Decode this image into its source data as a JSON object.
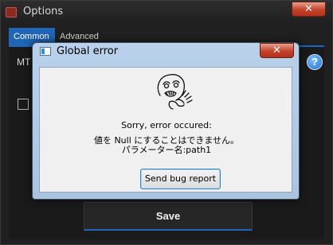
{
  "options_window": {
    "title": "Options",
    "close_glyph": "✕",
    "tabs": [
      {
        "label": "Common",
        "active": true
      },
      {
        "label": "Advanced",
        "active": false
      }
    ],
    "mt_label": "MT",
    "help_glyph": "?",
    "save_label": "Save"
  },
  "error_dialog": {
    "title": "Global error",
    "close_glyph": "✕",
    "icon": "rage-face-icon",
    "message": "Sorry, error occured:",
    "detail_line1": "値を Null にすることはできません。",
    "detail_line2": "パラメーター名:path1",
    "button_label": "Send bug report"
  },
  "colors": {
    "accent_blue": "#1f66b8",
    "close_red": "#c4412a",
    "dialog_frame": "#b9d1ea"
  }
}
